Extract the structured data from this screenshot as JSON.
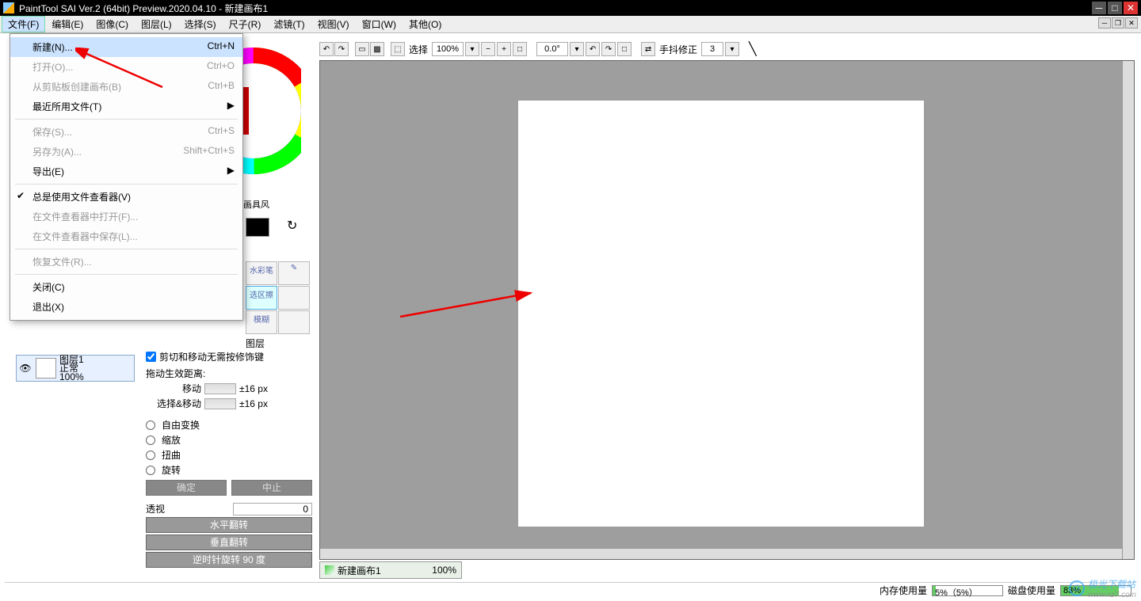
{
  "title": "PaintTool SAI Ver.2 (64bit) Preview.2020.04.10 - 新建画布1",
  "menubar": [
    "文件(F)",
    "编辑(E)",
    "图像(C)",
    "图层(L)",
    "选择(S)",
    "尺子(R)",
    "滤镜(T)",
    "视图(V)",
    "窗口(W)",
    "其他(O)"
  ],
  "dropdown": {
    "new": "新建(N)...",
    "new_sc": "Ctrl+N",
    "open": "打开(O)...",
    "open_sc": "Ctrl+O",
    "fromclip": "从剪贴板创建画布(B)",
    "fromclip_sc": "Ctrl+B",
    "recent": "最近所用文件(T)",
    "save": "保存(S)...",
    "save_sc": "Ctrl+S",
    "saveas": "另存为(A)...",
    "saveas_sc": "Shift+Ctrl+S",
    "export": "导出(E)",
    "useviewer": "总是使用文件查看器(V)",
    "openviewer": "在文件查看器中打开(F)...",
    "saveviewer": "在文件查看器中保存(L)...",
    "revert": "恢复文件(R)...",
    "close": "关闭(C)",
    "exit": "退出(X)"
  },
  "toolbar": {
    "select_label": "选择",
    "zoom": "100%",
    "angle": "0.0°",
    "stabilizer_label": "手抖修正",
    "stabilizer_value": "3"
  },
  "swatch_label": "画具风",
  "tools": {
    "brush": "水彩笔",
    "select": "选区擦",
    "blur": "模糊"
  },
  "layer_label": "图层",
  "layer": {
    "name": "图层1",
    "mode": "正常",
    "opacity": "100%"
  },
  "opts": {
    "checkbox": "剪切和移动无需按修饰键",
    "drag_label": "拖动生效距离:",
    "move": "移动",
    "move_val": "±16 px",
    "selmove": "选择&移动",
    "selmove_val": "±16 px",
    "free": "自由变换",
    "scale": "缩放",
    "distort": "扭曲",
    "rotate": "旋转",
    "ok": "确定",
    "cancel": "中止",
    "persp": "透视",
    "persp_val": "0",
    "fliph": "水平翻转",
    "flipv": "垂直翻转",
    "rot90": "逆时针旋转 90 度"
  },
  "doctab": {
    "name": "新建画布1",
    "zoom": "100%"
  },
  "status": {
    "mem_label": "内存使用量",
    "mem_text": "5%（5%）",
    "mem_pct": 5,
    "disk_label": "磁盘使用量",
    "disk_text": "83%",
    "disk_pct": 83
  },
  "watermark": "极光下载站",
  "watermark_url": "www.xz7.com"
}
